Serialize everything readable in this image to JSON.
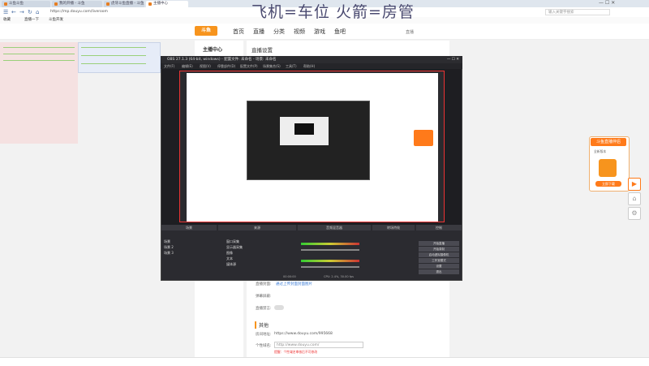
{
  "browser": {
    "tabs": [
      "斗鱼斗鱼",
      "我的开播 - 斗鱼",
      "虎牙斗鱼直播 - 斗鱼",
      "主播中心"
    ],
    "url": "https://mp.douyu.com/liveroom",
    "bookmarks": [
      "收藏",
      "直播一下",
      "斗鱼开发"
    ],
    "search_placeholder": "输入关键字搜索"
  },
  "headline": "飞机=车位 火箭=房管",
  "site": {
    "logo": "斗鱼",
    "nav": [
      "首页",
      "直播",
      "分类",
      "视频",
      "游戏",
      "鱼吧"
    ],
    "user": "直播",
    "left_title": "主播中心",
    "page_title": "直播设置",
    "rows": [
      {
        "label": "直播封面:",
        "value": "通过上传封面封面图片"
      },
      {
        "label": "弹幕屏蔽:",
        "value": ""
      },
      {
        "label": "直播禁言:",
        "value": ""
      }
    ],
    "section": "其他",
    "room_label": "房间地址:",
    "room_value": "https://www.douyu.com/995668",
    "link_label": "个性域名:",
    "link_value": "http://www.douyu.com/",
    "note": "提醒：个性域名审核后不可修改"
  },
  "obs": {
    "title": "OBS 27.1.3 (64-bit, windows) - 配置文件: 未命名 - 场景: 未命名",
    "menu": [
      "文件(F)",
      "编辑(E)",
      "视图(V)",
      "停靠部件(D)",
      "配置文件(P)",
      "场景集合(S)",
      "工具(T)",
      "帮助(H)"
    ],
    "docks": [
      "场景",
      "来源",
      "音频混音器",
      "转场特效",
      "控制"
    ],
    "scenes": [
      "场景",
      "场景 2",
      "场景 3"
    ],
    "sources": [
      "窗口采集",
      "显示器采集",
      "图像",
      "文本",
      "媒体源"
    ],
    "controls": [
      "开始直播",
      "开始录制",
      "启动虚拟摄像机",
      "工作室模式",
      "设置",
      "退出"
    ],
    "status": "CPU: 2.4%, 30.00 fps",
    "time": "00:00:00"
  },
  "promo": {
    "title": "斗鱼直播伴侣",
    "text": "全新版本",
    "button": "立即下载"
  }
}
